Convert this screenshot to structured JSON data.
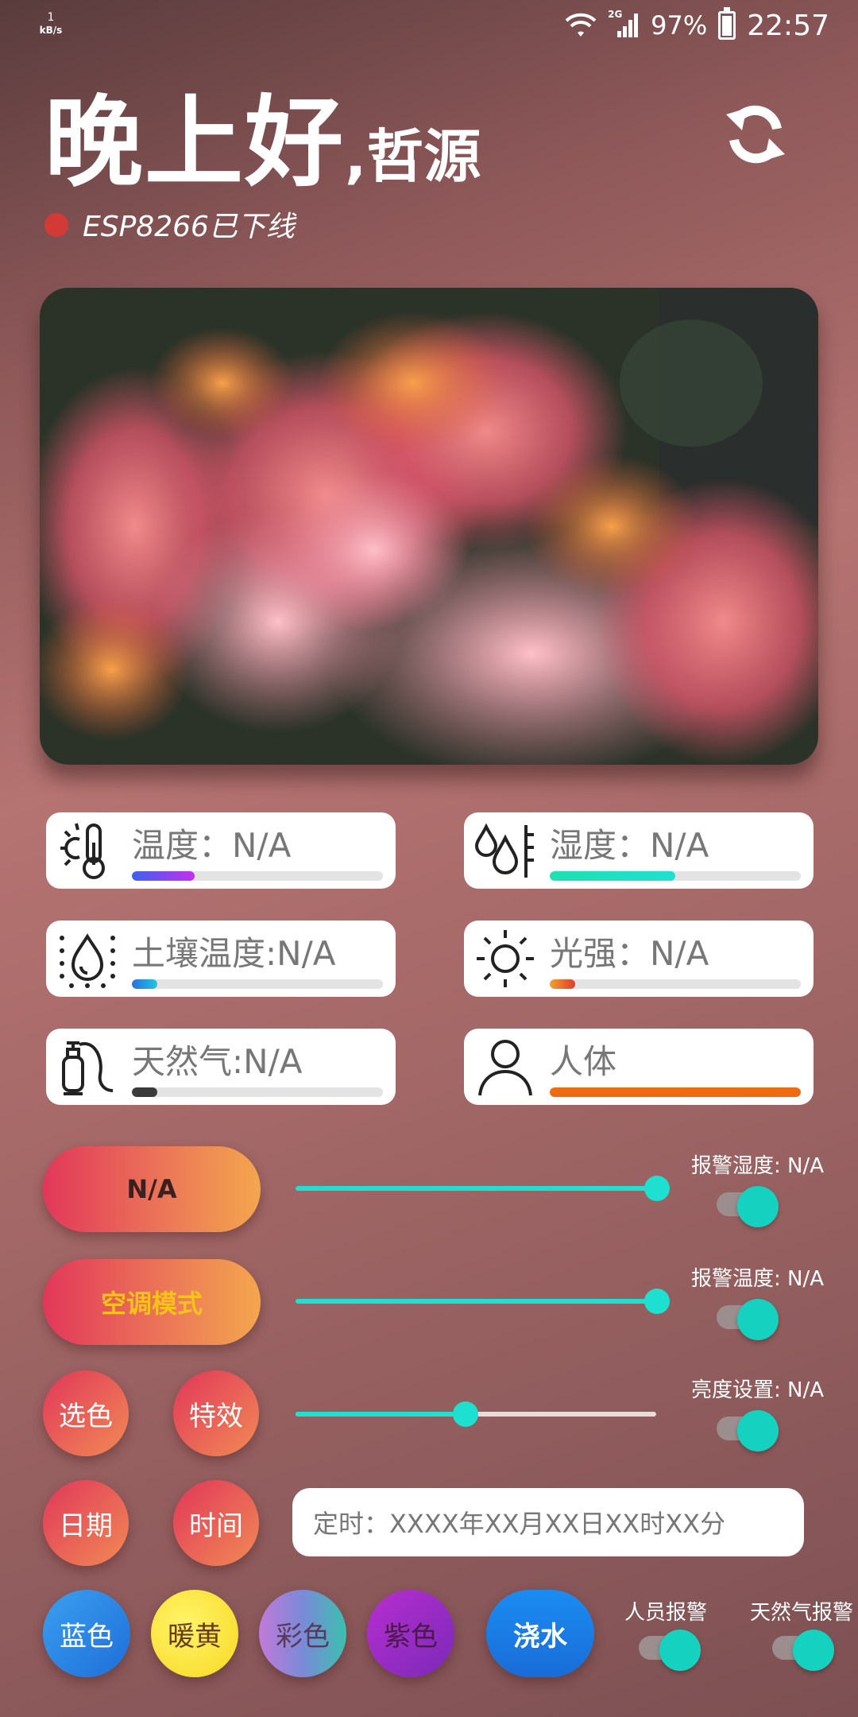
{
  "status_bar": {
    "speed_value": "1",
    "speed_unit": "kB/s",
    "network": "2G",
    "battery": "97%",
    "time": "22:57"
  },
  "header": {
    "greeting": "晚上好",
    "comma": ",",
    "name": "哲源",
    "device_status": "ESP8266已下线",
    "status_color": "#d33a35"
  },
  "sensors": {
    "temperature": {
      "label": "温度：N/A",
      "icon": "thermometer-icon",
      "level": 0.25
    },
    "humidity": {
      "label": "湿度：N/A",
      "icon": "humidity-drops-icon",
      "level": 0.5
    },
    "soil": {
      "label": "土壤温度:N/A",
      "icon": "soil-drop-icon",
      "level": 0.1
    },
    "light": {
      "label": "光强：N/A",
      "icon": "sun-icon",
      "level": 0.1
    },
    "gas": {
      "label": "天然气:N/A",
      "icon": "gas-tank-icon",
      "level": 0.1
    },
    "body": {
      "label": "人体",
      "icon": "person-icon",
      "level": 1.0
    }
  },
  "controls": {
    "na_button": "N/A",
    "ac_mode_button": "空调模式",
    "select_color_button": "选色",
    "effects_button": "特效",
    "date_button": "日期",
    "time_button": "时间",
    "alarm_humidity_label": "报警湿度: N/A",
    "alarm_temperature_label": "报警温度: N/A",
    "brightness_label": "亮度设置: N/A",
    "humidity_slider_level": 1.0,
    "temperature_slider_level": 1.0,
    "brightness_slider_level": 0.47,
    "timer_text": "定时：XXXX年XX月XX日XX时XX分"
  },
  "color_buttons": {
    "blue": "蓝色",
    "warm_yellow": "暖黄",
    "rainbow": "彩色",
    "purple": "紫色",
    "water": "浇水"
  },
  "alarms": {
    "person_alarm": "人员报警",
    "gas_alarm": "天然气报警"
  },
  "colors": {
    "accent_teal": "#1ee0d0",
    "pill_gradient_start": "#e2375a",
    "pill_gradient_end": "#f3a64d",
    "ac_mode_text": "#f7c21a",
    "water_blue": "#1a8df2"
  }
}
